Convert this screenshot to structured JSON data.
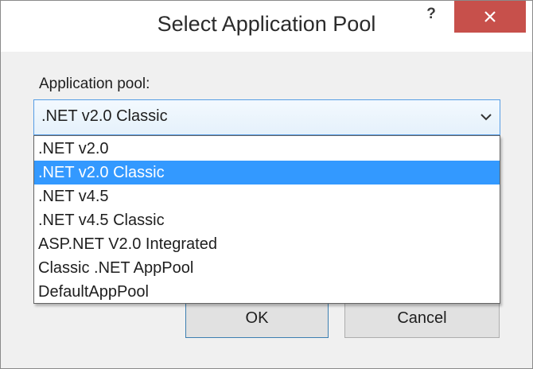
{
  "window": {
    "title": "Select Application Pool",
    "help_label": "?",
    "close_label": "close"
  },
  "form": {
    "label": "Application pool:",
    "selected_value": ".NET v2.0 Classic",
    "options": [
      ".NET v2.0",
      ".NET v2.0 Classic",
      ".NET v4.5",
      ".NET v4.5 Classic",
      "ASP.NET V2.0 Integrated",
      "Classic .NET AppPool",
      "DefaultAppPool"
    ],
    "highlighted_index": 1
  },
  "buttons": {
    "ok_label": "OK",
    "cancel_label": "Cancel"
  },
  "colors": {
    "selection": "#3399ff",
    "close_button": "#c7504b",
    "combo_border": "#569de5"
  }
}
